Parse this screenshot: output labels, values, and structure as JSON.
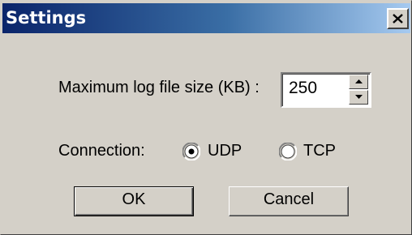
{
  "window": {
    "title": "Settings"
  },
  "settings": {
    "log_size_label": "Maximum log file size (KB) :",
    "log_size_value": "250",
    "connection_label": "Connection:",
    "connection_options": [
      {
        "label": "UDP",
        "selected": true
      },
      {
        "label": "TCP",
        "selected": false
      }
    ]
  },
  "buttons": {
    "ok_label": "OK",
    "cancel_label": "Cancel"
  },
  "icons": {
    "close": "close-icon",
    "spin_up": "arrow-up-icon",
    "spin_down": "arrow-down-icon"
  },
  "colors": {
    "title_bar_start": "#0a246a",
    "title_bar_end": "#a6caf0",
    "dialog_face": "#d4d0c8"
  }
}
